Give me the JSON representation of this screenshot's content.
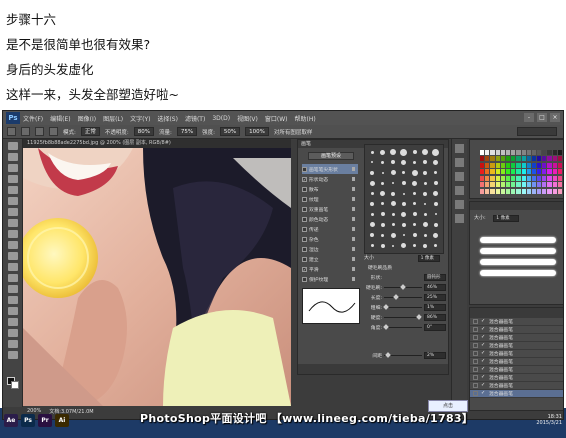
{
  "intro": {
    "line1": "步骤十六",
    "line2": "是不是很简单也很有效果?",
    "line3": "身后的头发虚化",
    "line4": "这样一来，头发全部塑造好啦~"
  },
  "ps": {
    "menu": [
      "文件(F)",
      "编辑(E)",
      "图像(I)",
      "图层(L)",
      "文字(Y)",
      "选择(S)",
      "滤镜(T)",
      "3D(D)",
      "视图(V)",
      "窗口(W)",
      "帮助(H)"
    ],
    "options": {
      "mode_label": "模式:",
      "mode_value": "正常",
      "opacity_label": "不透明度:",
      "opacity_value": "80%",
      "flow_label": "流量:",
      "flow_value": "75%",
      "strength_label": "强度:",
      "strength_value": "50%",
      "zoom_value": "100%",
      "sample_label": "对所有图层取样"
    },
    "doc_tab": "11925fb8b88ade2275bd.jpg @ 200% (图层 副本, RGB/8#)",
    "status": {
      "zoom": "200%",
      "doc": "文档:3.07M/21.0M"
    },
    "brush_panel": {
      "tabs": "画笔",
      "preset_button": "画笔预设",
      "items": [
        {
          "label": "画笔笔尖形状",
          "checked": false,
          "selected": true
        },
        {
          "label": "形状动态",
          "checked": true,
          "selected": false
        },
        {
          "label": "散布",
          "checked": false,
          "selected": false
        },
        {
          "label": "纹理",
          "checked": false,
          "selected": false
        },
        {
          "label": "双重画笔",
          "checked": false,
          "selected": false
        },
        {
          "label": "颜色动态",
          "checked": false,
          "selected": false
        },
        {
          "label": "传递",
          "checked": false,
          "selected": false
        },
        {
          "label": "杂色",
          "checked": false,
          "selected": false
        },
        {
          "label": "湿边",
          "checked": false,
          "selected": false
        },
        {
          "label": "建立",
          "checked": false,
          "selected": false
        },
        {
          "label": "平滑",
          "checked": true,
          "selected": false
        },
        {
          "label": "保护纹理",
          "checked": false,
          "selected": false
        }
      ],
      "size_label": "大小",
      "size_value": "1 像素",
      "shape_label": "硬毛刷品质",
      "shape_value": "圆钝形",
      "sliders": [
        {
          "label": "形状:",
          "value": "圆钝形"
        },
        {
          "label": "硬毛刷:",
          "value": "46%"
        },
        {
          "label": "长度:",
          "value": "25%"
        },
        {
          "label": "粗细:",
          "value": "1%"
        },
        {
          "label": "硬度:",
          "value": "86%"
        },
        {
          "label": "角度:",
          "value": "0°"
        }
      ],
      "spacing_label": "间距",
      "spacing_value": "2%"
    },
    "brushes": {
      "size_label": "大小:",
      "size_value": "1 像素"
    },
    "layers": [
      {
        "label": "混合器画笔",
        "selected": false
      },
      {
        "label": "混合器画笔",
        "selected": false
      },
      {
        "label": "混合器画笔",
        "selected": false
      },
      {
        "label": "混合器画笔",
        "selected": false
      },
      {
        "label": "混合器画笔",
        "selected": false
      },
      {
        "label": "混合器画笔",
        "selected": false
      },
      {
        "label": "混合器画笔",
        "selected": false
      },
      {
        "label": "混合器画笔",
        "selected": false
      },
      {
        "label": "混合器画笔",
        "selected": false
      },
      {
        "label": "混合器画笔",
        "selected": true
      }
    ]
  },
  "watermark": "PhotoShop平面设计吧 【www.lineeg.com/tieba/1783】",
  "wm_logo": "点击",
  "dock": [
    "Ae",
    "Ps",
    "Pr",
    "Ai"
  ],
  "clock": {
    "time": "18:31",
    "date": "2015/3/21"
  }
}
